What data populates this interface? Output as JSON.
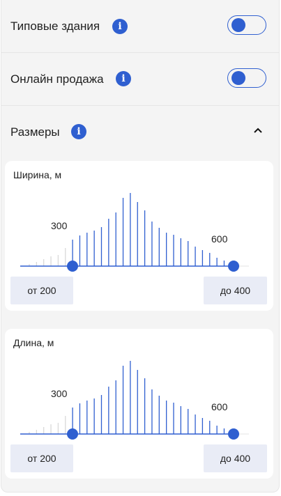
{
  "filters": {
    "typical": {
      "label": "Типовые здания",
      "enabled": false
    },
    "online": {
      "label": "Онлайн продажа",
      "enabled": false
    }
  },
  "sizes": {
    "label": "Размеры",
    "expanded": true,
    "width": {
      "title": "Ширина, м",
      "tick_left": "300",
      "tick_right": "600",
      "from": "от 200",
      "to": "до 400",
      "range": [
        200,
        400
      ]
    },
    "length": {
      "title": "Длина, м",
      "tick_left": "300",
      "tick_right": "600",
      "from": "от 200",
      "to": "до 400",
      "range": [
        200,
        400
      ]
    }
  },
  "colors": {
    "accent": "#2f5fd0",
    "inactive_bar": "#d9d9d9",
    "field_bg": "#e9ecf6"
  },
  "histogram": [
    3,
    6,
    10,
    14,
    16,
    26,
    38,
    44,
    48,
    51,
    56,
    68,
    77,
    98,
    105,
    92,
    80,
    64,
    55,
    48,
    45,
    40,
    36,
    28,
    23,
    19,
    12,
    8,
    5
  ]
}
